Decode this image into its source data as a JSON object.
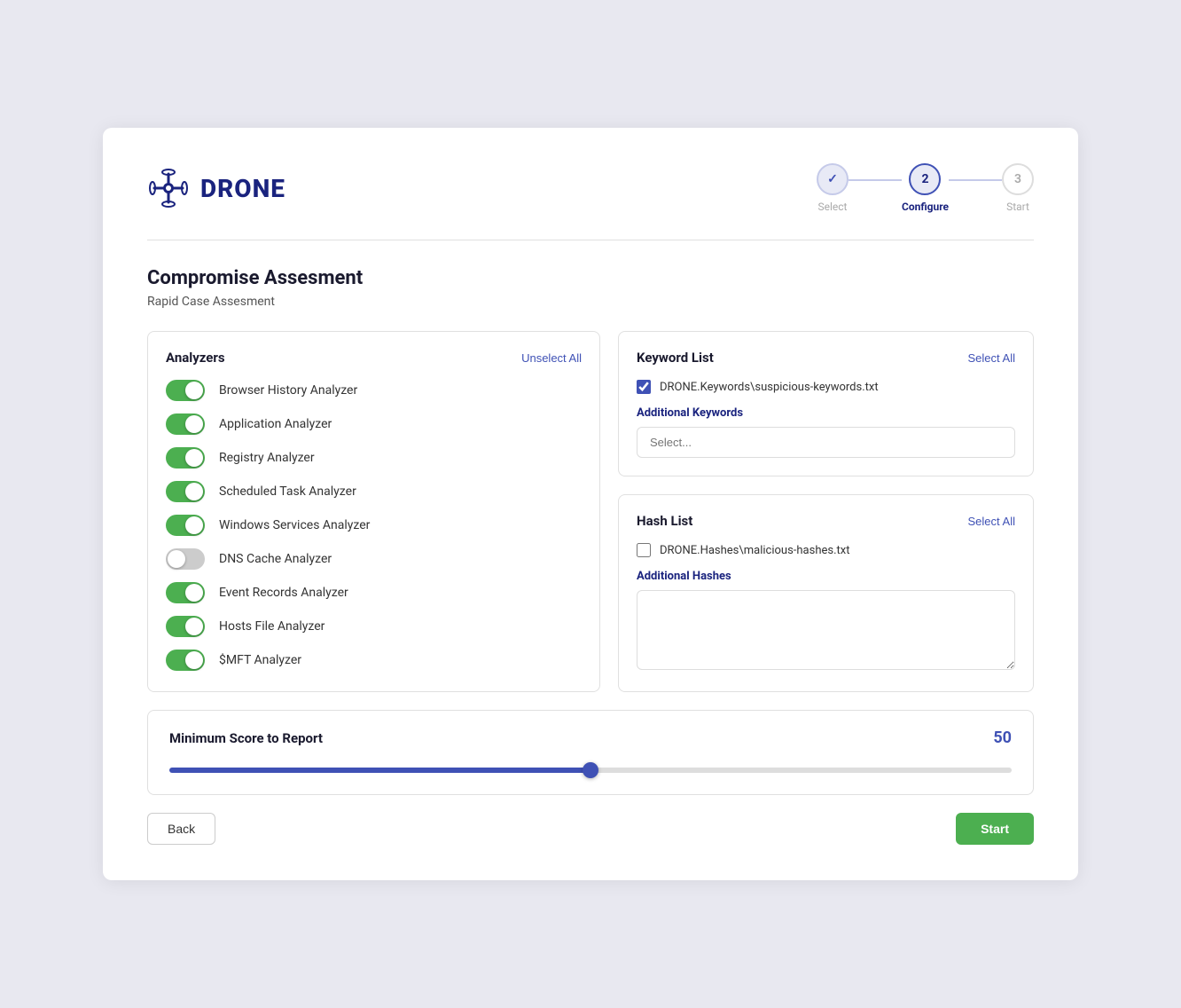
{
  "logo": {
    "text": "DRONE"
  },
  "stepper": {
    "steps": [
      {
        "id": "select",
        "number": "✓",
        "label": "Select",
        "state": "completed"
      },
      {
        "id": "configure",
        "number": "2",
        "label": "Configure",
        "state": "active"
      },
      {
        "id": "start",
        "number": "3",
        "label": "Start",
        "state": "inactive"
      }
    ]
  },
  "page": {
    "title": "Compromise Assesment",
    "subtitle": "Rapid Case Assesment"
  },
  "analyzers": {
    "title": "Analyzers",
    "unselect_all": "Unselect All",
    "items": [
      {
        "name": "Browser History Analyzer",
        "enabled": true
      },
      {
        "name": "Application Analyzer",
        "enabled": true
      },
      {
        "name": "Registry Analyzer",
        "enabled": true
      },
      {
        "name": "Scheduled Task Analyzer",
        "enabled": true
      },
      {
        "name": "Windows Services Analyzer",
        "enabled": true
      },
      {
        "name": "DNS Cache Analyzer",
        "enabled": false
      },
      {
        "name": "Event Records Analyzer",
        "enabled": true
      },
      {
        "name": "Hosts File Analyzer",
        "enabled": true
      },
      {
        "name": "$MFT Analyzer",
        "enabled": true
      }
    ]
  },
  "keyword_list": {
    "title": "Keyword List",
    "select_all": "Select All",
    "items": [
      {
        "name": "DRONE.Keywords\\suspicious-keywords.txt",
        "checked": true
      }
    ],
    "additional_keywords_label": "Additional Keywords",
    "additional_keywords_placeholder": "Select..."
  },
  "hash_list": {
    "title": "Hash List",
    "select_all": "Select All",
    "items": [
      {
        "name": "DRONE.Hashes\\malicious-hashes.txt",
        "checked": false
      }
    ],
    "additional_hashes_label": "Additional Hashes"
  },
  "score": {
    "title": "Minimum Score to Report",
    "value": "50",
    "slider_value": 50
  },
  "footer": {
    "back_label": "Back",
    "start_label": "Start"
  }
}
